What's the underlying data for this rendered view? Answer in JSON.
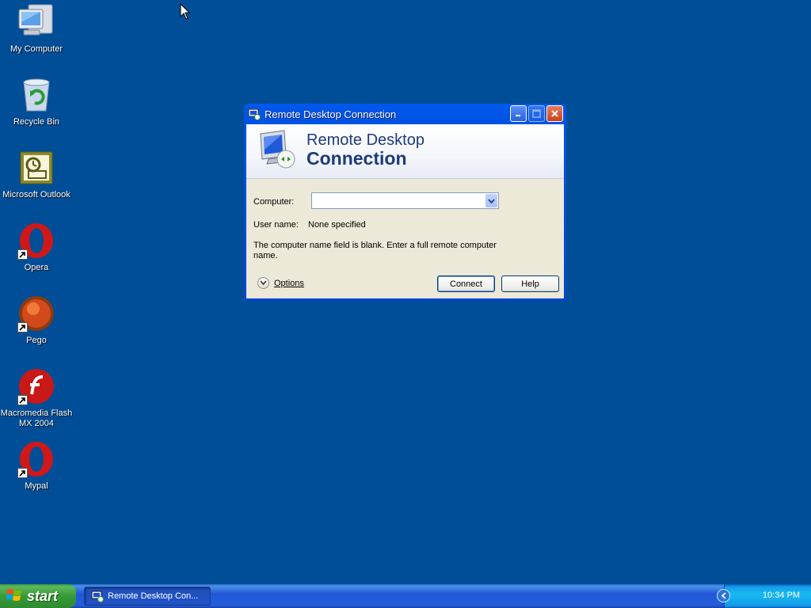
{
  "desktop": {
    "icons": [
      {
        "label": "My Computer"
      },
      {
        "label": "Recycle Bin"
      },
      {
        "label": "Microsoft Outlook"
      },
      {
        "label": "Opera"
      },
      {
        "label": "Pego"
      },
      {
        "label": "Macromedia Flash MX 2004"
      },
      {
        "label": "Mypal"
      }
    ]
  },
  "dialog": {
    "title": "Remote Desktop Connection",
    "banner_line1": "Remote Desktop",
    "banner_line2": "Connection",
    "computer_label": "Computer:",
    "computer_value": "",
    "username_label": "User name:",
    "username_value": "None specified",
    "message": "The computer name field is blank. Enter a full remote computer name.",
    "options_label": "Options",
    "connect_label": "Connect",
    "help_label": "Help"
  },
  "taskbar": {
    "start_label": "start",
    "task_label": "Remote Desktop Con...",
    "clock": "10:34 PM"
  },
  "colors": {
    "desktop": "#004e98",
    "title_blue": "#0054e3",
    "start_green": "#379a37"
  }
}
